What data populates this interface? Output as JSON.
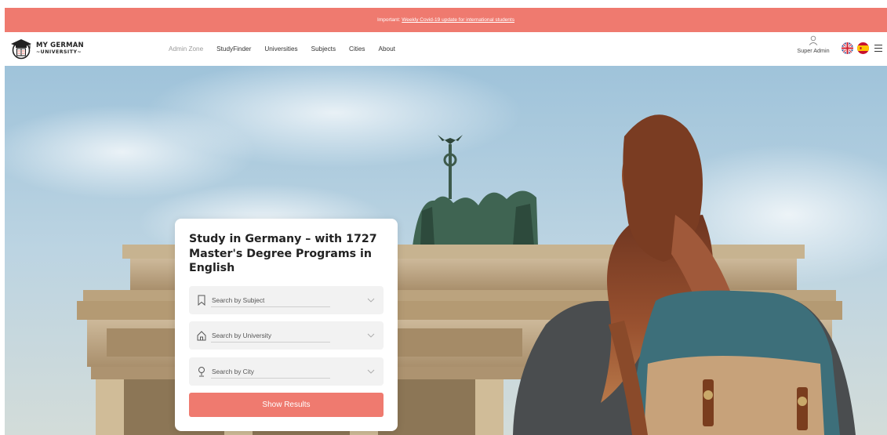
{
  "banner": {
    "prefix": "Important:",
    "link_text": "Weekly Covid-19 update for international students"
  },
  "logo": {
    "line1": "MY GERMAN",
    "line2": "~UNIVERSITY~"
  },
  "nav": {
    "items": [
      {
        "label": "Admin Zone"
      },
      {
        "label": "StudyFinder"
      },
      {
        "label": "Universities"
      },
      {
        "label": "Subjects"
      },
      {
        "label": "Cities"
      },
      {
        "label": "About"
      }
    ]
  },
  "user": {
    "label": "Super Admin",
    "icon": "user-icon"
  },
  "flags": [
    "uk-flag-icon",
    "spain-flag-icon"
  ],
  "hero": {
    "title": "Study in Germany – with 1727 Master's Degree Programs in English",
    "fields": [
      {
        "placeholder": "Search by Subject",
        "icon": "bookmark-icon"
      },
      {
        "placeholder": "Search by University",
        "icon": "home-icon"
      },
      {
        "placeholder": "Search by City",
        "icon": "location-pin-icon"
      }
    ],
    "button_label": "Show Results"
  },
  "colors": {
    "accent": "#ef7a6f",
    "text_dark": "#222222",
    "field_bg": "#f2f2f2"
  }
}
